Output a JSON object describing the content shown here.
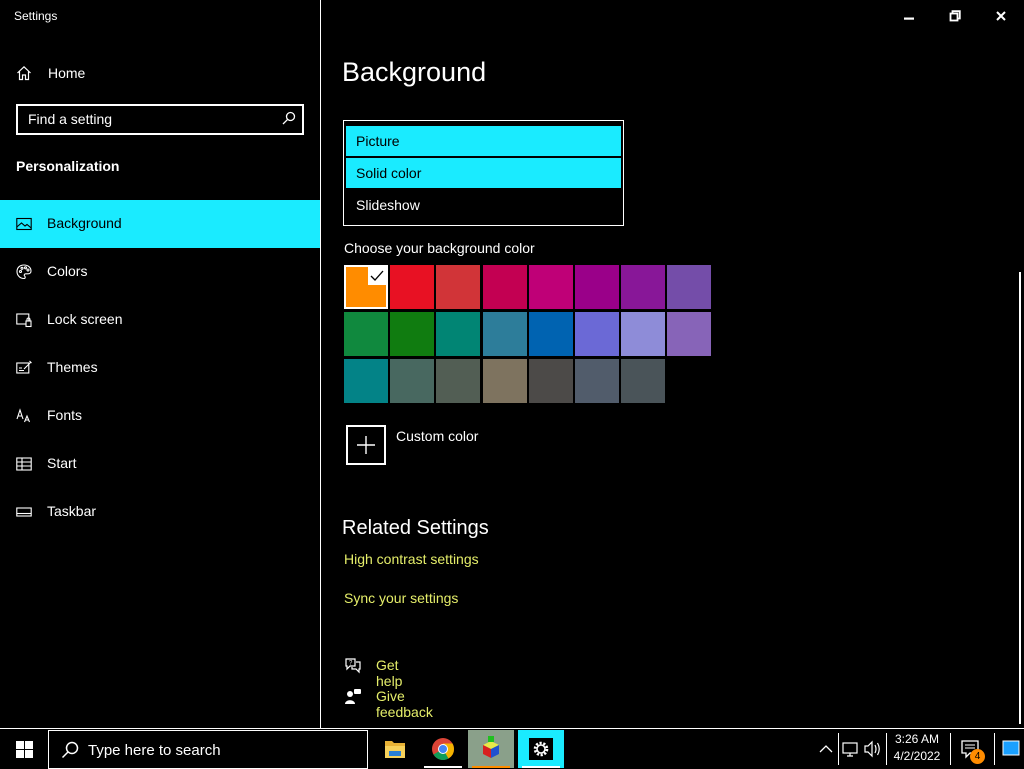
{
  "window": {
    "title": "Settings",
    "minimize_icon": "minimize-icon",
    "maximize_icon": "restore-icon",
    "close_icon": "close-icon"
  },
  "sidebar": {
    "home_label": "Home",
    "search_placeholder": "Find a setting",
    "section_title": "Personalization",
    "items": [
      {
        "label": "Background",
        "icon": "picture-icon",
        "active": true
      },
      {
        "label": "Colors",
        "icon": "palette-icon"
      },
      {
        "label": "Lock screen",
        "icon": "lock-screen-icon"
      },
      {
        "label": "Themes",
        "icon": "themes-icon"
      },
      {
        "label": "Fonts",
        "icon": "fonts-icon"
      },
      {
        "label": "Start",
        "icon": "start-icon"
      },
      {
        "label": "Taskbar",
        "icon": "taskbar-icon"
      }
    ]
  },
  "main": {
    "title": "Background",
    "background_dropdown": {
      "options": [
        "Picture",
        "Solid color",
        "Slideshow"
      ],
      "selected": "Solid color"
    },
    "choose_color_label": "Choose your background color",
    "colors": [
      "#ff8c00",
      "#e81123",
      "#d13438",
      "#c30052",
      "#bf0077",
      "#9a0089",
      "#881798",
      "#744da9",
      "#10893e",
      "#107c10",
      "#018574",
      "#2d7d9a",
      "#0063b1",
      "#6b69d6",
      "#8e8cd8",
      "#8764b8",
      "#038387",
      "#486860",
      "#525e54",
      "#7e735f",
      "#4c4a48",
      "#515c6b",
      "#4a5459"
    ],
    "selected_color": "#ff8c00",
    "custom_color_label": "Custom color",
    "related_settings_title": "Related Settings",
    "related_links": [
      "High contrast settings",
      "Sync your settings"
    ],
    "help": {
      "get_help": "Get help",
      "give_feedback": "Give feedback"
    },
    "accent_link_color": "#e5ee6a",
    "highlight_color": "#1aebff"
  },
  "taskbar": {
    "search_placeholder": "Type here to search",
    "apps": [
      "file-explorer-icon",
      "chrome-icon",
      "3d-viewer-icon",
      "settings-gear-icon"
    ],
    "time": "3:26 AM",
    "date": "4/2/2022",
    "notification_count": "4"
  }
}
